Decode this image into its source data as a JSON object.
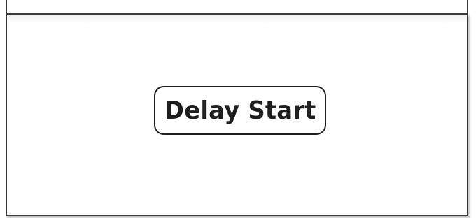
{
  "panel": {
    "button": {
      "label": "Delay Start"
    }
  },
  "colors": {
    "border": "#3a3a3a",
    "button_border": "#1f1f1f",
    "text": "#1f1f1f",
    "background": "#ffffff"
  }
}
